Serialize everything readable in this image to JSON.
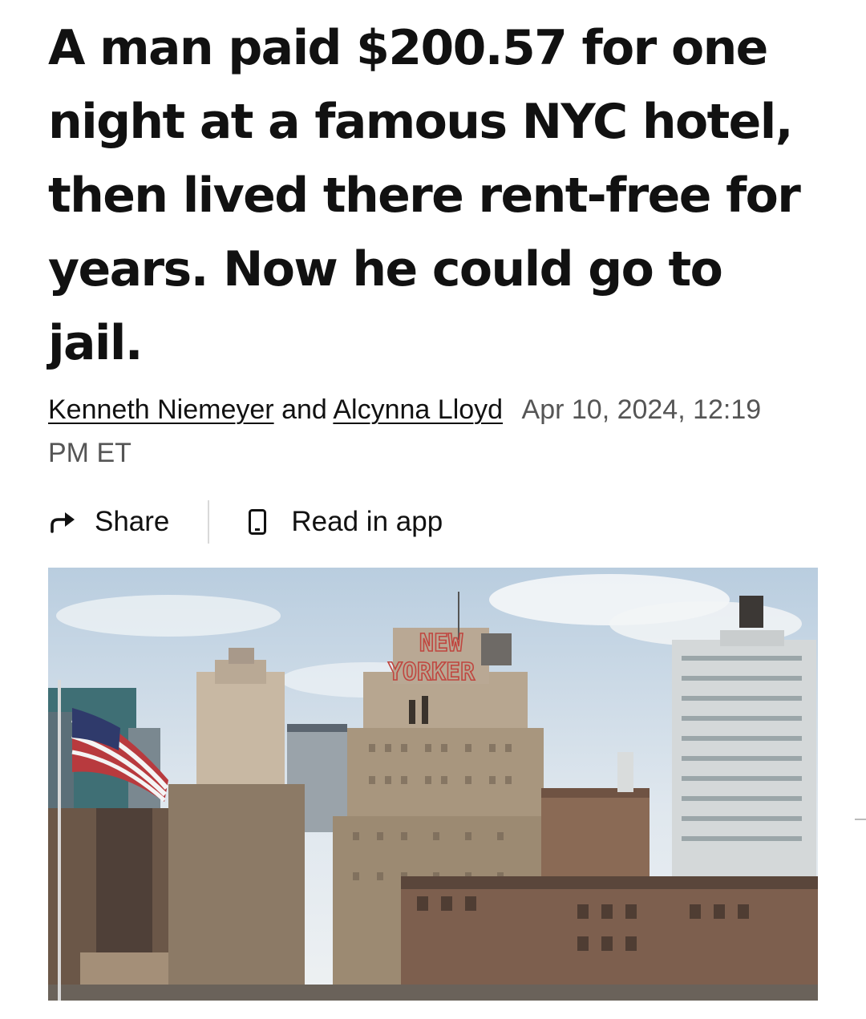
{
  "article": {
    "headline": "A man paid $200.57 for one night at a famous NYC hotel, then lived there rent-free for years. Now he could go to jail.",
    "authors": [
      "Kenneth Niemeyer",
      "Alcynna Lloyd"
    ],
    "author_joiner": "and",
    "published": "Apr 10, 2024, 12:19 PM ET"
  },
  "actions": {
    "share_label": "Share",
    "read_in_app_label": "Read in app",
    "share_icon": "share-arrow-icon",
    "app_icon": "phone-icon"
  },
  "hero_image": {
    "sign_line1": "NEW",
    "sign_line2": "YORKER"
  },
  "colors": {
    "text": "#111111",
    "meta_text": "#555555",
    "divider": "#d9d9d9",
    "sign_red": "#c0463f"
  }
}
